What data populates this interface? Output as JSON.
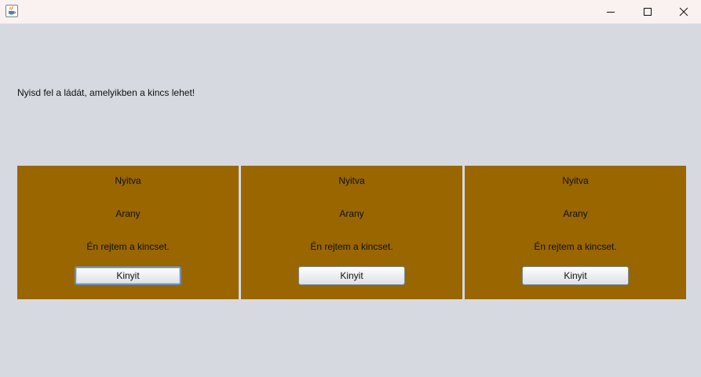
{
  "window": {
    "icon": "java-cup-icon",
    "controls": [
      "minimize-icon",
      "maximize-icon",
      "close-icon"
    ]
  },
  "prompt": "Nyisd fel a ládát, amelyikben a kincs lehet!",
  "chests": [
    {
      "status": "Nyitva",
      "material": "Arany",
      "inscription": "Én rejtem a kincset.",
      "button": "Kinyit",
      "focused": true
    },
    {
      "status": "Nyitva",
      "material": "Arany",
      "inscription": "Én rejtem a kincset.",
      "button": "Kinyit",
      "focused": false
    },
    {
      "status": "Nyitva",
      "material": "Arany",
      "inscription": "Én rejtem a kincset.",
      "button": "Kinyit",
      "focused": false
    }
  ],
  "colors": {
    "background": "#d6d9e0",
    "titlebar": "#faf1f1",
    "chest": "#996600"
  }
}
